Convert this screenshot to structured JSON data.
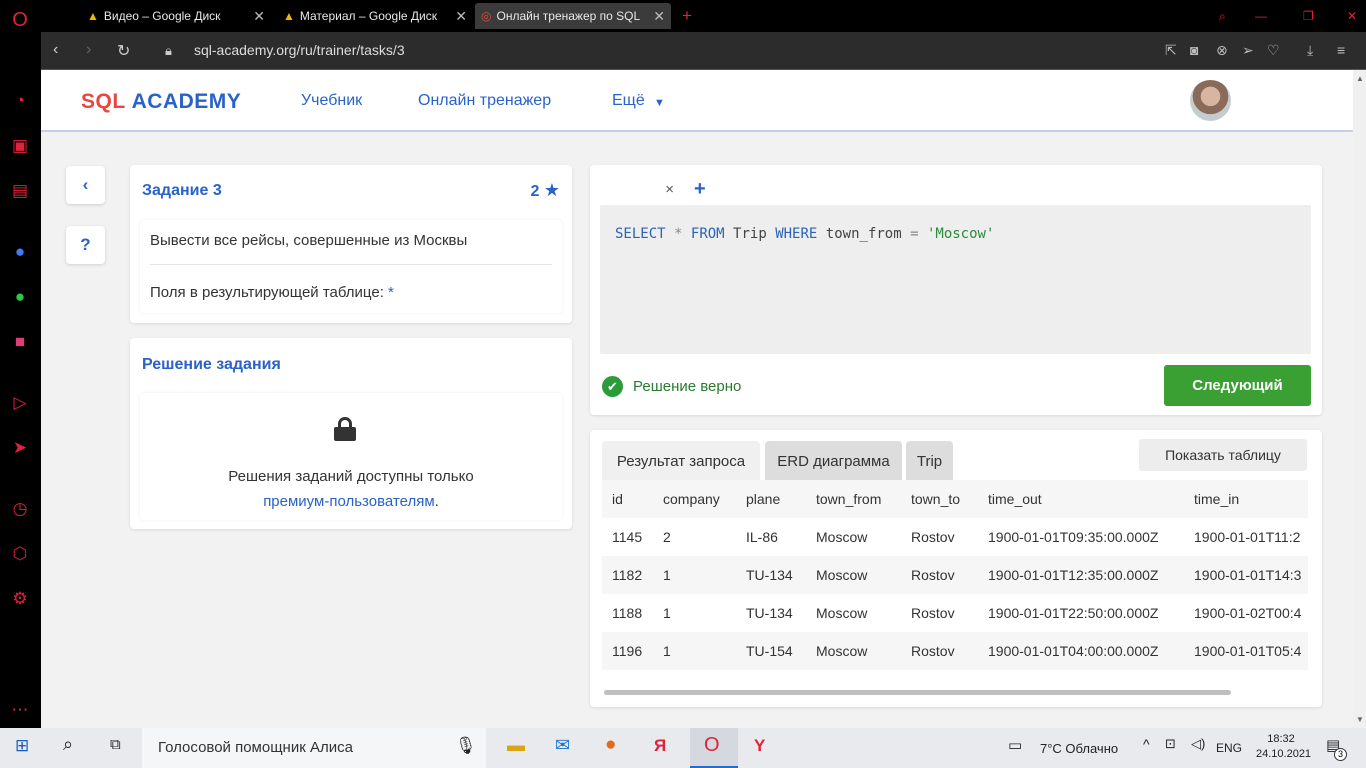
{
  "browser": {
    "tabs": [
      {
        "label": "Видео – Google Диск"
      },
      {
        "label": "Материал – Google Диск"
      },
      {
        "label": "Онлайн тренажер по SQL"
      }
    ],
    "url": "sql-academy.org/ru/trainer/tasks/3"
  },
  "header": {
    "logo_a": "SQL",
    "logo_b": "ACADEMY",
    "nav": [
      "Учебник",
      "Онлайн тренажер",
      "Ещё"
    ]
  },
  "side_buttons": {
    "back": "‹",
    "help": "?"
  },
  "task": {
    "title": "Задание 3",
    "stars": "2",
    "description": "Вывести все рейсы, совершенные из Москвы",
    "fields_label": "Поля в результирующей таблице:",
    "fields_value": "*"
  },
  "solution": {
    "title": "Решение задания",
    "locked_text": "Решения заданий доступны только",
    "locked_link": "премиум-пользователям",
    "locked_end": "."
  },
  "editor": {
    "tab_close": "×",
    "tab_add": "+",
    "query_parts": {
      "select": "SELECT",
      "star": "*",
      "from": "FROM",
      "table": "Trip",
      "where": "WHERE",
      "col": "town_from",
      "eq": "=",
      "val": "'Moscow'"
    },
    "status": "Решение верно",
    "next_button": "Следующий"
  },
  "results": {
    "tabs": [
      "Результат запроса",
      "ERD диаграмма",
      "Trip"
    ],
    "show_table": "Показать таблицу",
    "columns": [
      "id",
      "company",
      "plane",
      "town_from",
      "town_to",
      "time_out",
      "time_in"
    ],
    "rows": [
      [
        "1145",
        "2",
        "IL-86",
        "Moscow",
        "Rostov",
        "1900-01-01T09:35:00.000Z",
        "1900-01-01T11:2"
      ],
      [
        "1182",
        "1",
        "TU-134",
        "Moscow",
        "Rostov",
        "1900-01-01T12:35:00.000Z",
        "1900-01-01T14:3"
      ],
      [
        "1188",
        "1",
        "TU-134",
        "Moscow",
        "Rostov",
        "1900-01-01T22:50:00.000Z",
        "1900-01-02T00:4"
      ],
      [
        "1196",
        "1",
        "TU-154",
        "Moscow",
        "Rostov",
        "1900-01-01T04:00:00.000Z",
        "1900-01-01T05:4"
      ]
    ]
  },
  "taskbar": {
    "search": "Голосовой помощник Алиса",
    "weather": "7°C  Облачно",
    "lang": "ENG",
    "time": "18:32",
    "date": "24.10.2021",
    "notif_count": "3"
  },
  "colors": {
    "accent": "#2962c9",
    "success": "#3aa033",
    "opera": "#e0223a"
  }
}
